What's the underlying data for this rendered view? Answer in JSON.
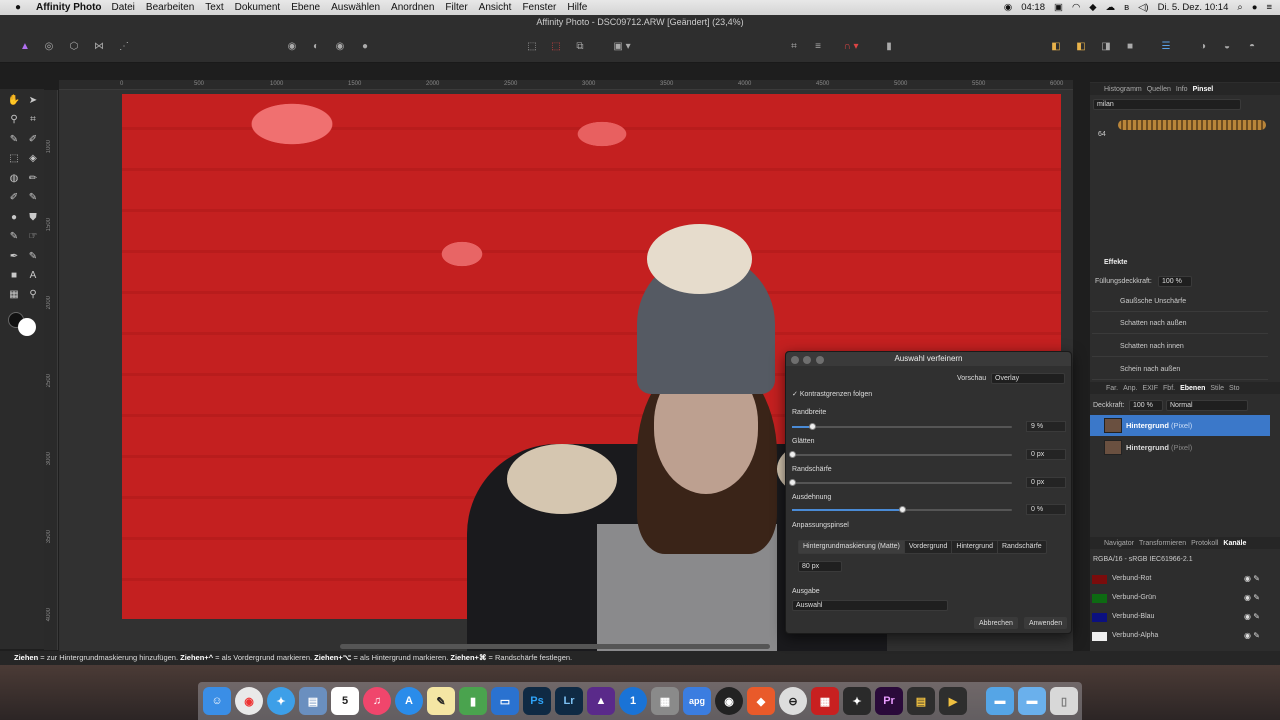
{
  "menubar": {
    "app_name": "Affinity Photo",
    "items": [
      "Datei",
      "Bearbeiten",
      "Text",
      "Dokument",
      "Ebene",
      "Auswählen",
      "Anordnen",
      "Filter",
      "Ansicht",
      "Fenster",
      "Hilfe"
    ],
    "clock_timer": "04:18",
    "datetime": "Di. 5. Dez.  10:14"
  },
  "window": {
    "title": "Affinity Photo - DSC09712.ARW [Geändert] (23,4%)"
  },
  "ruler": {
    "h_ticks": [
      "0",
      "500",
      "1000",
      "1500",
      "2000",
      "2500",
      "3000",
      "3500",
      "4000",
      "4500",
      "5000",
      "5500",
      "6000"
    ],
    "v_ticks": [
      "1000",
      "1500",
      "2000",
      "2500",
      "3000",
      "3500",
      "4000"
    ]
  },
  "statusbar": {
    "k1": "Ziehen",
    "t1": " = zur Hintergrundmaskierung hinzufügen. ",
    "k2": "Ziehen+^",
    "t2": " = als Vordergrund markieren. ",
    "k3": "Ziehen+⌥",
    "t3": " = als Hintergrund markieren. ",
    "k4": "Ziehen+⌘",
    "t4": " = Randschärfe festlegen."
  },
  "panel_top": {
    "tabs": [
      "Histogramm",
      "Quellen",
      "Info",
      "Pinsel"
    ],
    "brush_category": "milan",
    "brush_size": "64"
  },
  "effects": {
    "header": "Effekte",
    "opacity_label": "Füllungsdeckkraft:",
    "opacity_value": "100 %",
    "items": [
      "Gaußsche Unschärfe",
      "Schatten nach außen",
      "Schatten nach innen",
      "Schein nach außen"
    ]
  },
  "layers_panel": {
    "tabs": [
      "Far.",
      "Anp.",
      "EXIF",
      "Fbf.",
      "Ebenen",
      "Stile",
      "Sto"
    ],
    "opacity_label": "Deckkraft:",
    "opacity_value": "100 %",
    "blend_mode": "Normal",
    "layers": [
      {
        "name": "Hintergrund",
        "type": "(Pixel)"
      },
      {
        "name": "Hintergrund",
        "type": "(Pixel)"
      }
    ]
  },
  "channels_panel": {
    "tabs": [
      "Navigator",
      "Transformieren",
      "Protokoll",
      "Kanäle"
    ],
    "color_format": "RGBA/16 - sRGB IEC61966-2.1",
    "channels": [
      {
        "name": "Verbund-Rot",
        "color": "#7a0c0c"
      },
      {
        "name": "Verbund-Grün",
        "color": "#0d6a12"
      },
      {
        "name": "Verbund-Blau",
        "color": "#0b1080"
      },
      {
        "name": "Verbund-Alpha",
        "color": "#f0f0f0"
      }
    ]
  },
  "refine_dialog": {
    "title": "Auswahl verfeinern",
    "preview_label": "Vorschau",
    "preview_value": "Overlay",
    "checkbox_label": "Kontrastgrenzen folgen",
    "sliders": [
      {
        "label": "Randbreite",
        "value": "9 %",
        "fraction": 0.09
      },
      {
        "label": "Glätten",
        "value": "0 px",
        "fraction": 0
      },
      {
        "label": "Randschärfe",
        "value": "0 px",
        "fraction": 0
      },
      {
        "label": "Ausdehnung",
        "value": "0 %",
        "fraction": 0.5
      }
    ],
    "brush_section": "Anpassungspinsel",
    "brush_modes": [
      "Hintergrundmaskierung (Matte)",
      "Vordergrund",
      "Hintergrund",
      "Randschärfe"
    ],
    "brush_size": "80 px",
    "output_label": "Ausgabe",
    "output_value": "Auswahl",
    "cancel": "Abbrechen",
    "apply": "Anwenden"
  },
  "dock": {
    "labels": [
      "Ps",
      "Lr",
      "Pr"
    ]
  }
}
